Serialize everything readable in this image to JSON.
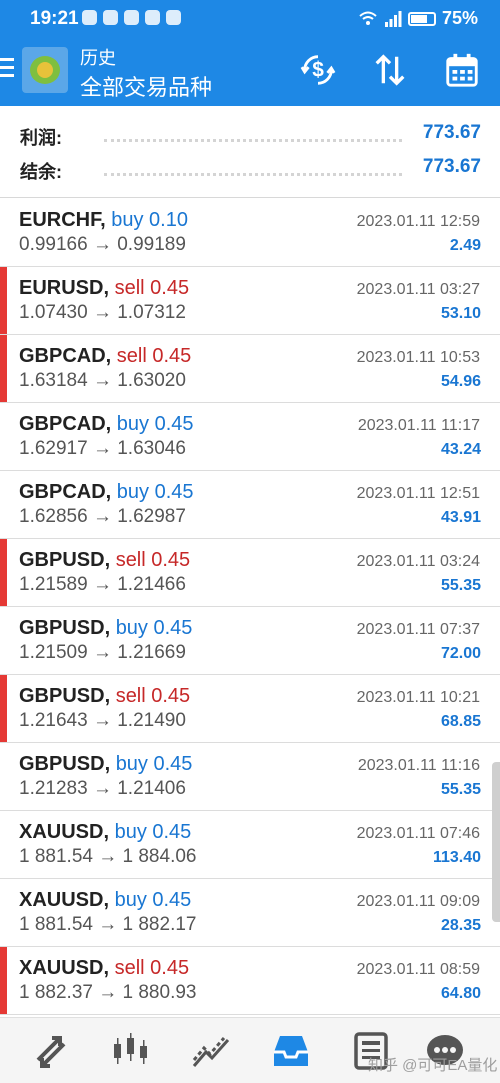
{
  "status_bar": {
    "time": "19:21",
    "battery": "75%"
  },
  "header": {
    "subtitle": "历史",
    "title": "全部交易品种"
  },
  "summary": {
    "profit_label": "利润:",
    "profit_value": "773.67",
    "balance_label": "结余:",
    "balance_value": "773.67"
  },
  "trades": [
    {
      "symbol": "EURCHF,",
      "side": "buy",
      "lots": "buy 0.10",
      "prices": "0.99166 → 0.99189",
      "datetime": "2023.01.11 12:59",
      "profit": "2.49"
    },
    {
      "symbol": "EURUSD,",
      "side": "sell",
      "lots": "sell 0.45",
      "prices": "1.07430 → 1.07312",
      "datetime": "2023.01.11 03:27",
      "profit": "53.10"
    },
    {
      "symbol": "GBPCAD,",
      "side": "sell",
      "lots": "sell 0.45",
      "prices": "1.63184 → 1.63020",
      "datetime": "2023.01.11 10:53",
      "profit": "54.96"
    },
    {
      "symbol": "GBPCAD,",
      "side": "buy",
      "lots": "buy 0.45",
      "prices": "1.62917 → 1.63046",
      "datetime": "2023.01.11 11:17",
      "profit": "43.24"
    },
    {
      "symbol": "GBPCAD,",
      "side": "buy",
      "lots": "buy 0.45",
      "prices": "1.62856 → 1.62987",
      "datetime": "2023.01.11 12:51",
      "profit": "43.91"
    },
    {
      "symbol": "GBPUSD,",
      "side": "sell",
      "lots": "sell 0.45",
      "prices": "1.21589 → 1.21466",
      "datetime": "2023.01.11 03:24",
      "profit": "55.35"
    },
    {
      "symbol": "GBPUSD,",
      "side": "buy",
      "lots": "buy 0.45",
      "prices": "1.21509 → 1.21669",
      "datetime": "2023.01.11 07:37",
      "profit": "72.00"
    },
    {
      "symbol": "GBPUSD,",
      "side": "sell",
      "lots": "sell 0.45",
      "prices": "1.21643 → 1.21490",
      "datetime": "2023.01.11 10:21",
      "profit": "68.85"
    },
    {
      "symbol": "GBPUSD,",
      "side": "buy",
      "lots": "buy 0.45",
      "prices": "1.21283 → 1.21406",
      "datetime": "2023.01.11 11:16",
      "profit": "55.35"
    },
    {
      "symbol": "XAUUSD,",
      "side": "buy",
      "lots": "buy 0.45",
      "prices": "1 881.54 → 1 884.06",
      "datetime": "2023.01.11 07:46",
      "profit": "113.40"
    },
    {
      "symbol": "XAUUSD,",
      "side": "buy",
      "lots": "buy 0.45",
      "prices": "1 881.54 → 1 882.17",
      "datetime": "2023.01.11 09:09",
      "profit": "28.35"
    },
    {
      "symbol": "XAUUSD,",
      "side": "sell",
      "lots": "sell 0.45",
      "prices": "1 882.37 → 1 880.93",
      "datetime": "2023.01.11 08:59",
      "profit": "64.80"
    }
  ],
  "bottom_nav": {
    "items": [
      "quotes-icon",
      "chart-icon",
      "trade-icon",
      "history-icon",
      "news-icon",
      "chat-icon"
    ],
    "watermark": "知乎 @可可EA量化"
  },
  "colors": {
    "header_bg": "#1e88e5",
    "buy": "#1976d2",
    "sell": "#c62828",
    "sell_marker": "#e53935",
    "active_nav": "#1e88e5"
  }
}
